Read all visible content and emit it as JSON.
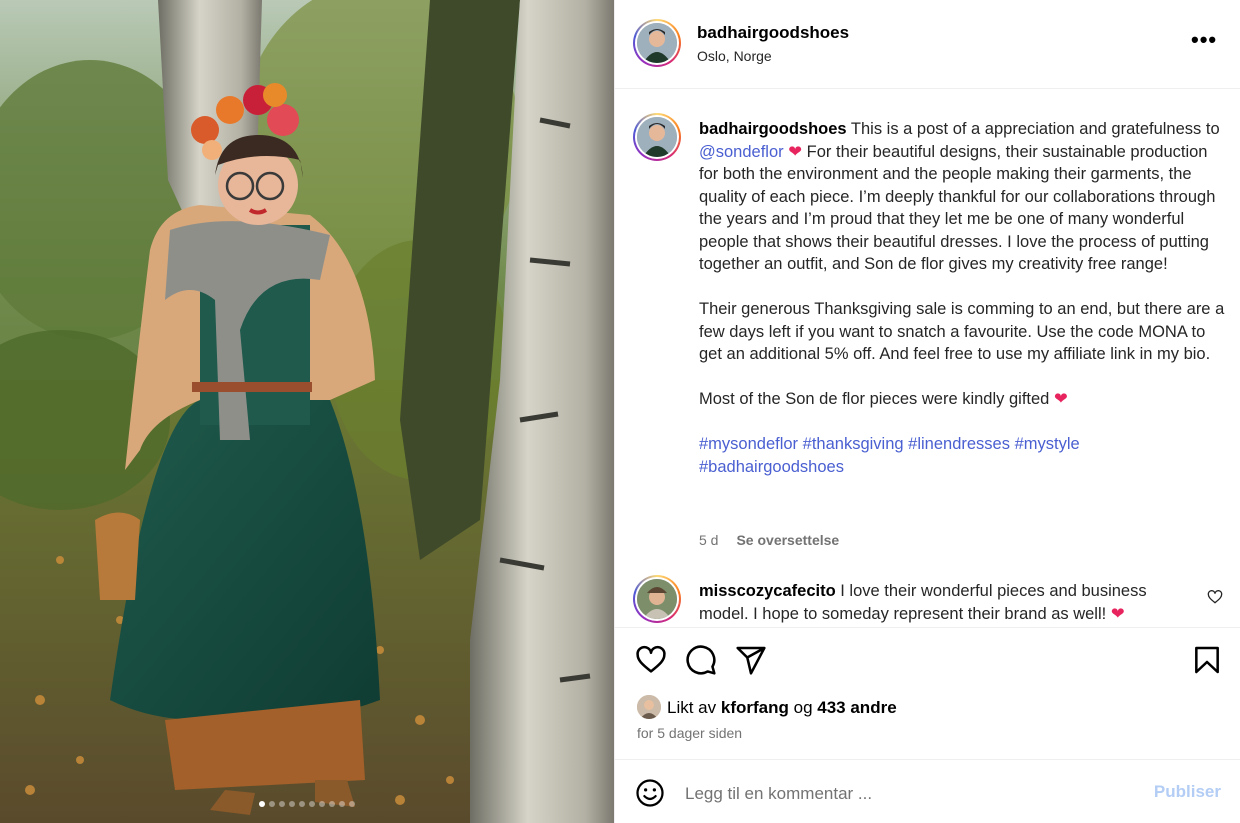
{
  "post": {
    "username": "badhairgoodshoes",
    "location": "Oslo, Norge",
    "more_icon": "more-horizontal-icon",
    "carousel": {
      "total_slides": 10,
      "active_index": 0
    }
  },
  "caption": {
    "username": "badhairgoodshoes",
    "intro": "This is a post of a appreciation and gratefulness to",
    "mention": "@sondeflor",
    "heart": "❤",
    "p1_rest": "For their beautiful designs, their sustainable production for both the environment and the people making their garments, the quality of each piece. I’m deeply thankful for our collaborations through the years and I’m proud that they let me be one of many wonderful people that shows their beautiful dresses. I love the process of putting together an outfit, and Son de flor gives my creativity free range!",
    "p2": "Their generous Thanksgiving sale is comming to an end, but there are a few days left if you want to snatch a favourite. Use the code MONA to get an additional 5% off. And feel free to use my affiliate link in my bio.",
    "p3": "Most of the Son de flor pieces were kindly gifted",
    "p3_heart": "❤",
    "hashtags": [
      "#mysondeflor",
      "#thanksgiving",
      "#linendresses",
      "#mystyle",
      "#badhairgoodshoes"
    ],
    "age": "5 d",
    "translate": "Se oversettelse"
  },
  "comment": {
    "username": "misscozycafecito",
    "text": "I love their wonderful pieces and business model. I hope to someday represent their brand as well!",
    "heart": "❤"
  },
  "likes": {
    "prefix": "Likt av",
    "user": "kforfang",
    "and": "og",
    "others": "433 andre",
    "ago": "for 5 dager siden"
  },
  "composer": {
    "placeholder": "Legg til en kommentar ...",
    "publish_label": "Publiser"
  },
  "colors": {
    "link": "#4a5fd1",
    "heart": "#e8245e",
    "publish_disabled": "#b3cdf5",
    "muted": "#737373"
  }
}
